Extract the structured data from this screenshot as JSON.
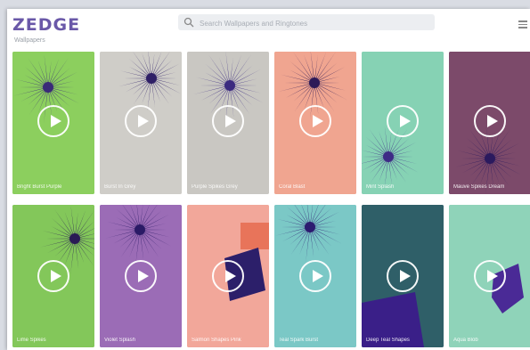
{
  "app": {
    "logo": "ZEDGE"
  },
  "search": {
    "placeholder": "Search Wallpapers and Ringtones"
  },
  "breadcrumb": {
    "text": "Wallpapers"
  },
  "cards": [
    {
      "title": "Bright Burst Purple",
      "bg": "#8ccf5e",
      "burst": "#3a2a78"
    },
    {
      "title": "Burst In Grey",
      "bg": "#cfcdc8",
      "burst": "#2e1f66"
    },
    {
      "title": "Purple Spikes Grey",
      "bg": "#c9c7c2",
      "burst": "#3b2a80"
    },
    {
      "title": "Coral Blast",
      "bg": "#f0a590",
      "burst": "#2c1a58"
    },
    {
      "title": "Mint Splash",
      "bg": "#86d2b4",
      "burst": "#3e2a86"
    },
    {
      "title": "Mauve Spikes Dream",
      "bg": "#7c4a6a",
      "burst": "#2b1a5e"
    },
    {
      "title": "Lime Spikes",
      "bg": "#83c75a",
      "burst": "#2a1a55"
    },
    {
      "title": "Violet Splash",
      "bg": "#9b6cb6",
      "burst": "#2a1a66"
    },
    {
      "title": "Salmon Shapes Pink",
      "bg": "#f2a79a",
      "burst": "#2c1f6a"
    },
    {
      "title": "Teal Spark Burst",
      "bg": "#7bc8c6",
      "burst": "#2c1a70"
    },
    {
      "title": "Deep Teal Shapes",
      "bg": "#2f5f68",
      "burst": "#3a1f88"
    },
    {
      "title": "Aqua Blob",
      "bg": "#8fd3b9",
      "burst": "#4a2a96"
    }
  ]
}
